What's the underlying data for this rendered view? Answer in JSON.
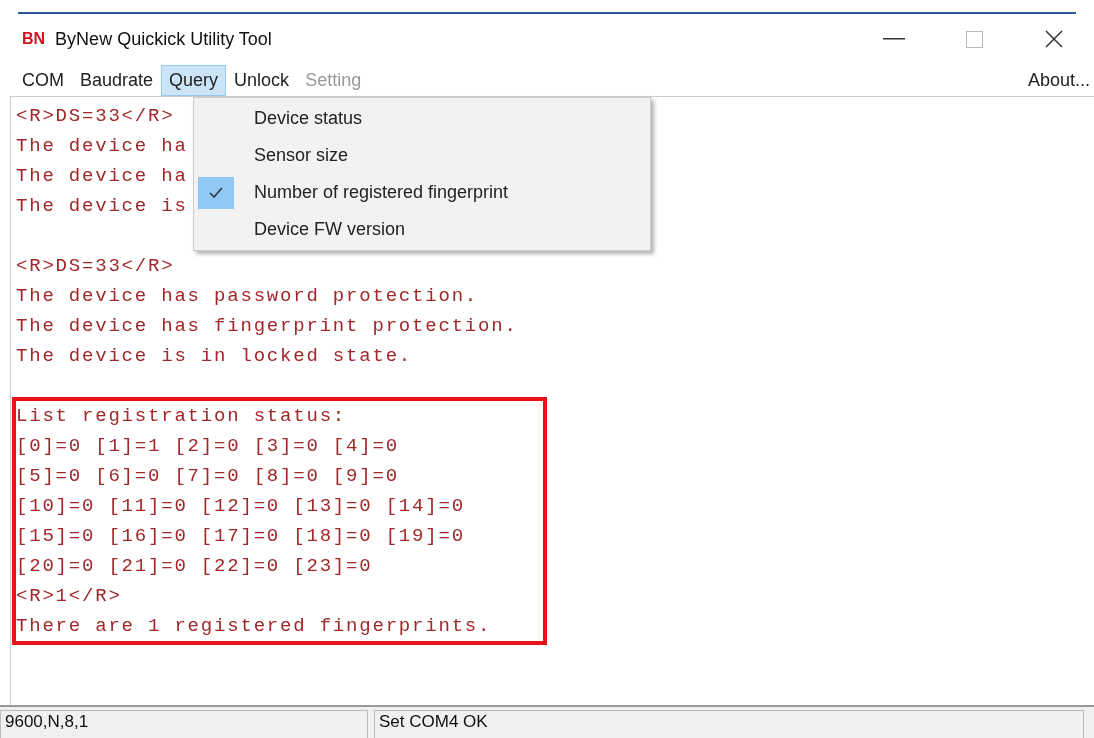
{
  "window": {
    "logo": "BN",
    "title": "ByNew Quickick Utility Tool"
  },
  "menubar": {
    "items": [
      {
        "label": "COM",
        "selected": false,
        "disabled": false
      },
      {
        "label": "Baudrate",
        "selected": false,
        "disabled": false
      },
      {
        "label": "Query",
        "selected": true,
        "disabled": false
      },
      {
        "label": "Unlock",
        "selected": false,
        "disabled": false
      },
      {
        "label": "Setting",
        "selected": false,
        "disabled": true
      }
    ],
    "about": "About..."
  },
  "dropdown": {
    "items": [
      {
        "label": "Device status",
        "checked": false
      },
      {
        "label": "Sensor size",
        "checked": false
      },
      {
        "label": "Number of registered fingerprint",
        "checked": true
      },
      {
        "label": "Device FW version",
        "checked": false
      }
    ]
  },
  "log": {
    "blocks": [
      {
        "highlighted": false,
        "lines": [
          "<R>DS=33</R>",
          "The device ha",
          "The device ha",
          "The device is"
        ]
      },
      {
        "highlighted": false,
        "lines": [
          "<R>DS=33</R>",
          "The device has password protection.",
          "The device has fingerprint protection.",
          "The device is in locked state."
        ]
      },
      {
        "highlighted": true,
        "lines": [
          "List registration status:",
          "[0]=0 [1]=1 [2]=0 [3]=0 [4]=0",
          "[5]=0 [6]=0 [7]=0 [8]=0 [9]=0",
          "[10]=0 [11]=0 [12]=0 [13]=0 [14]=0",
          "[15]=0 [16]=0 [17]=0 [18]=0 [19]=0",
          "[20]=0 [21]=0 [22]=0 [23]=0",
          "<R>1</R>",
          "There are 1 registered fingerprints."
        ]
      }
    ]
  },
  "status_bar": {
    "panels": [
      "9600,N,8,1",
      "Set COM4 OK"
    ]
  }
}
